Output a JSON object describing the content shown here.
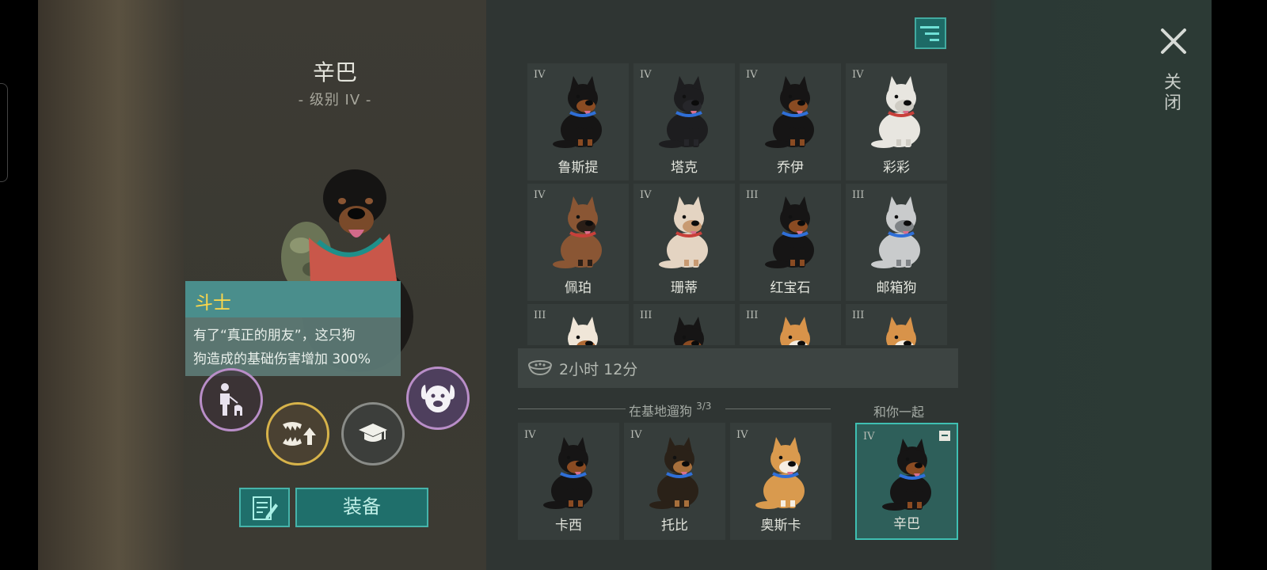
{
  "header": {
    "dog_name": "辛巴",
    "dog_level": "- 级别 IV -"
  },
  "tooltip": {
    "title": "斗士",
    "body_line1": "有了“真正的朋友”，这只狗",
    "body_line2": "狗造成的基础伤害增加 300%"
  },
  "skills": [
    "walk-with-dog-icon",
    "fang-upgrade-icon",
    "graduation-cap-icon",
    "dog-face-icon"
  ],
  "actions": {
    "equip_label": "装备",
    "note_icon": "note-edit-icon"
  },
  "roster": [
    {
      "tier": "IV",
      "name": "鲁斯提",
      "breed": "rottweiler"
    },
    {
      "tier": "IV",
      "name": "塔克",
      "breed": "black-shepherd"
    },
    {
      "tier": "IV",
      "name": "乔伊",
      "breed": "rottweiler"
    },
    {
      "tier": "IV",
      "name": "彩彩",
      "breed": "white-husky"
    },
    {
      "tier": "IV",
      "name": "佩珀",
      "breed": "shepherd-brown"
    },
    {
      "tier": "IV",
      "name": "珊蒂",
      "breed": "akita-cream"
    },
    {
      "tier": "III",
      "name": "红宝石",
      "breed": "rottweiler"
    },
    {
      "tier": "III",
      "name": "邮箱狗",
      "breed": "grey-husky"
    },
    {
      "tier": "III",
      "name": "",
      "breed": "saint-bernard"
    },
    {
      "tier": "III",
      "name": "",
      "breed": "rottweiler"
    },
    {
      "tier": "III",
      "name": "",
      "breed": "corgi"
    },
    {
      "tier": "III",
      "name": "",
      "breed": "corgi"
    }
  ],
  "food": {
    "icon": "food-bowl-icon",
    "timer": "2小时 12分"
  },
  "walk_section": {
    "label": "在基地遛狗",
    "count": "3/3"
  },
  "walking_dogs": [
    {
      "tier": "IV",
      "name": "卡西",
      "breed": "rottweiler"
    },
    {
      "tier": "IV",
      "name": "托比",
      "breed": "german-shepherd"
    },
    {
      "tier": "IV",
      "name": "奥斯卡",
      "breed": "shiba"
    }
  ],
  "with_you": {
    "label": "和你一起",
    "tier": "IV",
    "name": "辛巴",
    "breed": "rottweiler"
  },
  "close": {
    "label": "关闭"
  },
  "colors": {
    "accent": "#1f6f6b",
    "accent_border": "#46b3aa",
    "tooltip_title": "#ffd84a"
  }
}
